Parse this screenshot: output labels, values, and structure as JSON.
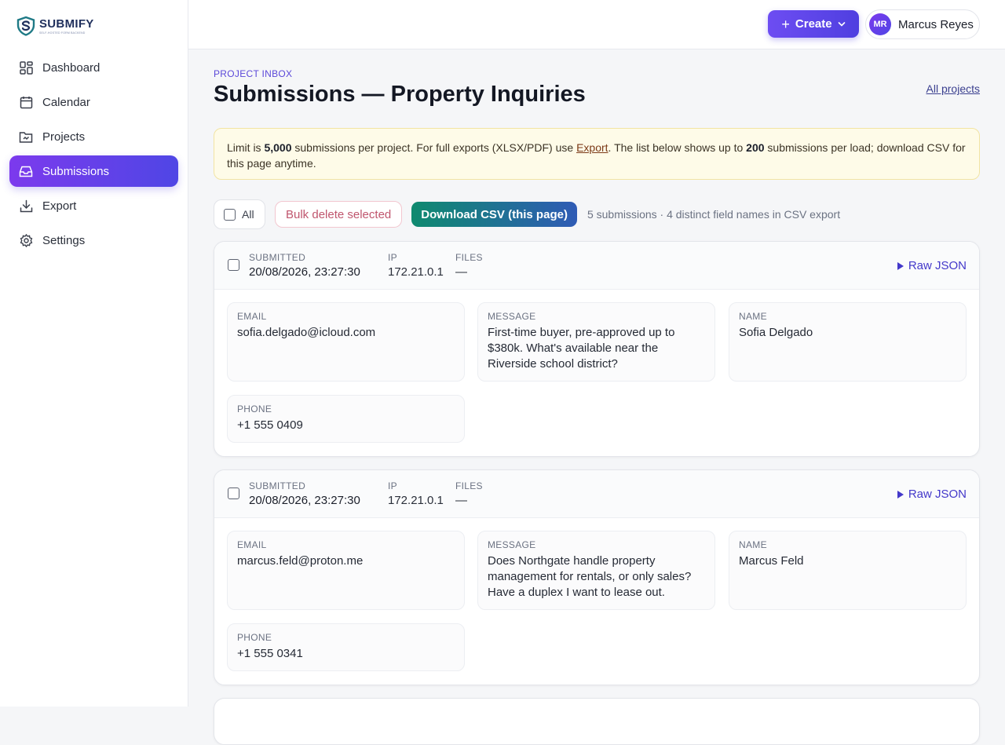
{
  "brand": {
    "name": "SUBMIFY",
    "tagline": "SELF-HOSTED FORM BACKEND"
  },
  "sidebar": {
    "items": [
      {
        "label": "Dashboard",
        "icon": "dashboard-icon"
      },
      {
        "label": "Calendar",
        "icon": "calendar-icon"
      },
      {
        "label": "Projects",
        "icon": "folder-icon"
      },
      {
        "label": "Submissions",
        "icon": "inbox-icon",
        "active": true
      },
      {
        "label": "Export",
        "icon": "download-icon"
      },
      {
        "label": "Settings",
        "icon": "gear-icon"
      }
    ]
  },
  "topbar": {
    "create_label": "Create",
    "user": {
      "initials": "MR",
      "name": "Marcus Reyes"
    }
  },
  "header": {
    "eyebrow": "PROJECT INBOX",
    "title": "Submissions — Property Inquiries",
    "all_projects": "All projects"
  },
  "notice": {
    "t1": "Limit is ",
    "limit": "5,000",
    "t2": " submissions per project. For full exports (XLSX/PDF) use ",
    "export_link": "Export",
    "t3": ". The list below shows up to ",
    "per_load": "200",
    "t4": " submissions per load; download CSV for this page anytime."
  },
  "toolbar": {
    "all_label": "All",
    "bulk_delete": "Bulk delete selected",
    "download_csv": "Download CSV (this page)",
    "summary": "5 submissions · 4 distinct field names in CSV export"
  },
  "labels": {
    "submitted": "SUBMITTED",
    "ip": "IP",
    "files": "FILES",
    "raw_json": "Raw JSON",
    "email": "EMAIL",
    "message": "MESSAGE",
    "name": "NAME",
    "phone": "PHONE"
  },
  "submissions": [
    {
      "submitted": "20/08/2026, 23:27:30",
      "ip": "172.21.0.1",
      "files": "—",
      "email": "sofia.delgado@icloud.com",
      "message": "First-time buyer, pre-approved up to $380k. What's available near the Riverside school district?",
      "name": "Sofia Delgado",
      "phone": "+1 555 0409"
    },
    {
      "submitted": "20/08/2026, 23:27:30",
      "ip": "172.21.0.1",
      "files": "—",
      "email": "marcus.feld@proton.me",
      "message": "Does Northgate handle property management for rentals, or only sales? Have a duplex I want to lease out.",
      "name": "Marcus Feld",
      "phone": "+1 555 0341"
    }
  ]
}
